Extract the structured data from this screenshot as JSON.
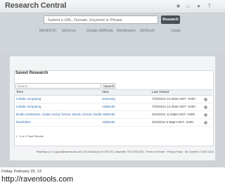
{
  "header": {
    "app_title": "Research Central"
  },
  "search": {
    "placeholder": "Submit a URL, Domain, Keyword or Phrase",
    "button_label": "Research"
  },
  "partners": [
    "MAJESTIC",
    "SEOmoz",
    "Google AdWords",
    "Wordtracker",
    "SEMrush",
    "Calais"
  ],
  "saved": {
    "title": "Saved Research",
    "filter_placeholder": "Search...",
    "search_button": "Search",
    "columns": [
      "Term",
      "View",
      "Last Viewed"
    ],
    "rows": [
      {
        "term": "mobile computing",
        "view": "Summary",
        "viewed": "7/20/2012 12:30am EDT -0400"
      },
      {
        "term": "mobile computing",
        "view": "AdWords",
        "viewed": "7/20/2012 12:30am EDT -0400"
      },
      {
        "term": "kindle tombstone, create social, format, ebook, format, kindle",
        "view": "AdWords",
        "viewed": "6/22/2011 11:59pm EDT -0400"
      },
      {
        "term": "backlinksn",
        "view": "AdWords",
        "viewed": "6/22/2011 8:58pm EDT -0400"
      }
    ],
    "pager": "1 - 4 of 4 Total Results"
  },
  "footer": {
    "text": "Raventop LLC support@raventools.com 1101 McGavock St STE 301, Nashville, TN 37203 USA · Terms of Service · Privacy Policy · All Contents © 2007-2013"
  },
  "caption": {
    "date": "Friday, February 20, 13",
    "url": "http://raventools.com"
  }
}
